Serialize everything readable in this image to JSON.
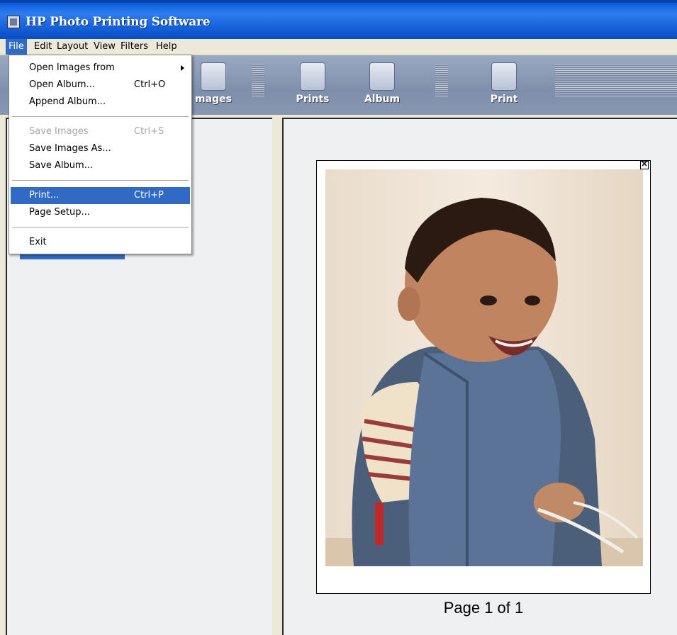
{
  "window": {
    "title": "HP Photo Printing Software"
  },
  "menubar": {
    "items": [
      "File",
      "Edit",
      "Layout",
      "View",
      "Filters",
      "Help"
    ]
  },
  "toolbar": {
    "buttons": [
      "mages",
      "Prints",
      "Album",
      "Print"
    ]
  },
  "file_menu": {
    "items": [
      {
        "label": "Open Images from",
        "shortcut": "",
        "submenu": true
      },
      {
        "label": "Open Album...",
        "shortcut": "Ctrl+O"
      },
      {
        "label": "Append Album...",
        "shortcut": ""
      },
      {
        "label": "Save Images",
        "shortcut": "Ctrl+S",
        "disabled": true
      },
      {
        "label": "Save Images As...",
        "shortcut": ""
      },
      {
        "label": "Save Album...",
        "shortcut": ""
      },
      {
        "label": "Print...",
        "shortcut": "Ctrl+P",
        "highlighted": true
      },
      {
        "label": "Page Setup...",
        "shortcut": ""
      },
      {
        "label": "Exit",
        "shortcut": ""
      }
    ]
  },
  "preview": {
    "caption": "Page 1 of 1",
    "close_glyph": "✕"
  },
  "colors": {
    "title_blue": "#0a5bd9",
    "menu_highlight": "#316ac5",
    "toolbar": "#8796b1"
  }
}
